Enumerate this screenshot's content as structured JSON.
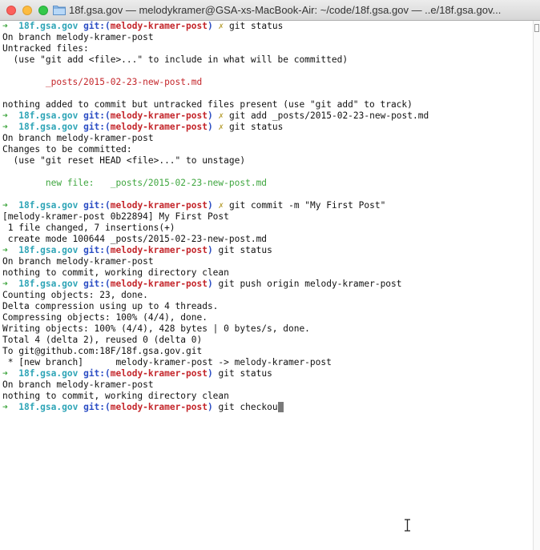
{
  "window": {
    "title": "18f.gsa.gov — melodykramer@GSA-xs-MacBook-Air: ~/code/18f.gsa.gov — ..e/18f.gsa.gov..."
  },
  "icons": [
    "close-icon",
    "minimize-icon",
    "maximize-icon",
    "folder-icon",
    "text-cursor-icon"
  ],
  "colors": {
    "prompt_arrow": "#3fa63f",
    "prompt_dir": "#2fa5b7",
    "prompt_git": "#2b4dc4",
    "prompt_branch": "#c4262b",
    "dirty_mark": "#b9a23a",
    "untracked_file": "#c4262b",
    "staged_file": "#3fa63f"
  },
  "prompt": {
    "arrow": "➜",
    "dir": "18f.gsa.gov",
    "git": "git:(",
    "branch": "melody-kramer-post",
    "close": ")",
    "dirty": "✗"
  },
  "terminal": {
    "l1_cmd": " git status",
    "l2": "On branch melody-kramer-post",
    "l3": "Untracked files:",
    "l4": "  (use \"git add <file>...\" to include in what will be committed)",
    "l5": "",
    "l6_file": "        _posts/2015-02-23-new-post.md",
    "l7": "",
    "l8": "nothing added to commit but untracked files present (use \"git add\" to track)",
    "l9_cmd": " git add _posts/2015-02-23-new-post.md",
    "l10_cmd": " git status",
    "l11": "On branch melody-kramer-post",
    "l12": "Changes to be committed:",
    "l13": "  (use \"git reset HEAD <file>...\" to unstage)",
    "l14": "",
    "l15_file": "        new file:   _posts/2015-02-23-new-post.md",
    "l16": "",
    "l17_cmd": " git commit -m \"My First Post\"",
    "l18": "[melody-kramer-post 0b22894] My First Post",
    "l19": " 1 file changed, 7 insertions(+)",
    "l20": " create mode 100644 _posts/2015-02-23-new-post.md",
    "l21_cmd": " git status",
    "l22": "On branch melody-kramer-post",
    "l23": "nothing to commit, working directory clean",
    "l24_cmd": " git push origin melody-kramer-post",
    "l25": "Counting objects: 23, done.",
    "l26": "Delta compression using up to 4 threads.",
    "l27": "Compressing objects: 100% (4/4), done.",
    "l28": "Writing objects: 100% (4/4), 428 bytes | 0 bytes/s, done.",
    "l29": "Total 4 (delta 2), reused 0 (delta 0)",
    "l30": "To git@github.com:18F/18f.gsa.gov.git",
    "l31": " * [new branch]      melody-kramer-post -> melody-kramer-post",
    "l32_cmd": " git status",
    "l33": "On branch melody-kramer-post",
    "l34": "nothing to commit, working directory clean",
    "l35_cmd": " git checkou"
  }
}
